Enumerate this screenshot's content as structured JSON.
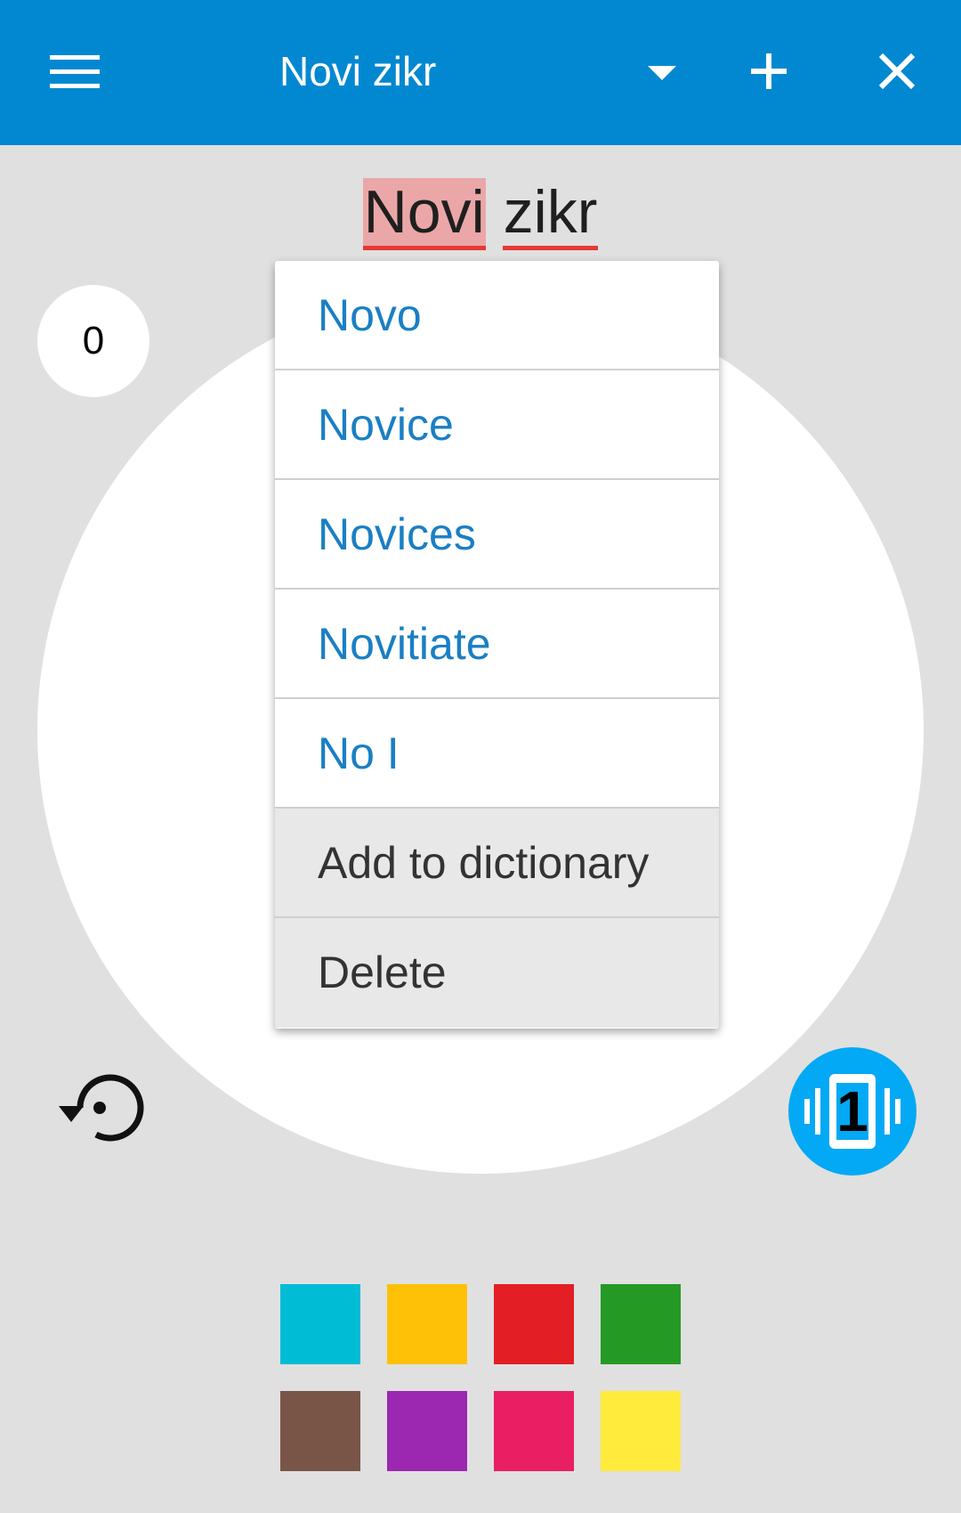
{
  "appbar": {
    "title": "Novi zikr",
    "background": "#0288d1"
  },
  "name_field": {
    "word1": "Novi",
    "word2": "zikr"
  },
  "counter": {
    "count": "0"
  },
  "spell_popup": {
    "suggestions": [
      "Novo",
      "Novice",
      "Novices",
      "Novitiate",
      "No I"
    ],
    "actions": [
      "Add to dictionary",
      "Delete"
    ]
  },
  "vibrate_button": {
    "value": "1",
    "color": "#03a9f4"
  },
  "colors": {
    "row1": [
      "#00bcd4",
      "#ffc107",
      "#e31e24",
      "#249a24"
    ],
    "row2": [
      "#795548",
      "#9c27b0",
      "#e91e63",
      "#ffeb3b"
    ]
  },
  "icons": [
    "menu-icon",
    "dropdown-arrow-icon",
    "plus-icon",
    "close-icon",
    "reset-icon",
    "vibrate-icon"
  ]
}
